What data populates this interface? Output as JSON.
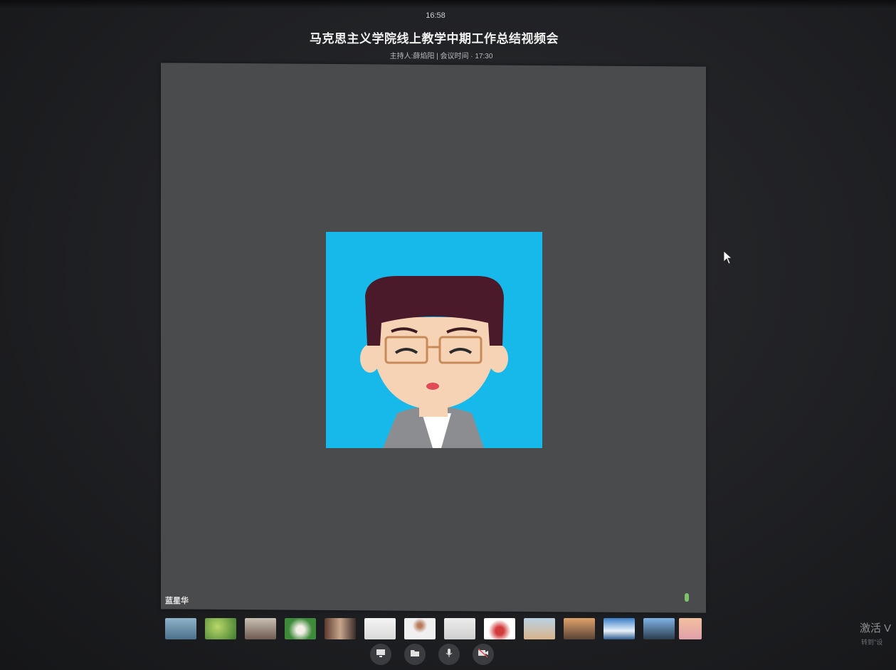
{
  "header": {
    "time": "16:58",
    "title": "马克思主义学院线上教学中期工作总结视频会",
    "subtitle": "主持人:薛焰阳 | 会议时间 · 17:30"
  },
  "stage": {
    "speaker_name": "蓝星华",
    "avatar_icon": "cartoon-avatar-icon",
    "accent_color": "#17b9ea"
  },
  "participants": [
    {
      "name": "participant-1"
    },
    {
      "name": "participant-2"
    },
    {
      "name": "participant-3"
    },
    {
      "name": "participant-4"
    },
    {
      "name": "participant-5"
    },
    {
      "name": "participant-6"
    },
    {
      "name": "participant-7"
    },
    {
      "name": "participant-8"
    },
    {
      "name": "participant-9"
    },
    {
      "name": "participant-10"
    },
    {
      "name": "participant-11"
    },
    {
      "name": "participant-12"
    },
    {
      "name": "participant-13"
    },
    {
      "name": "participant-14"
    }
  ],
  "controls": [
    {
      "icon": "screen-share-icon"
    },
    {
      "icon": "folder-icon"
    },
    {
      "icon": "microphone-icon"
    },
    {
      "icon": "camera-off-icon"
    }
  ],
  "watermark": {
    "line1": "激活 V",
    "line2": "转到\"设"
  }
}
